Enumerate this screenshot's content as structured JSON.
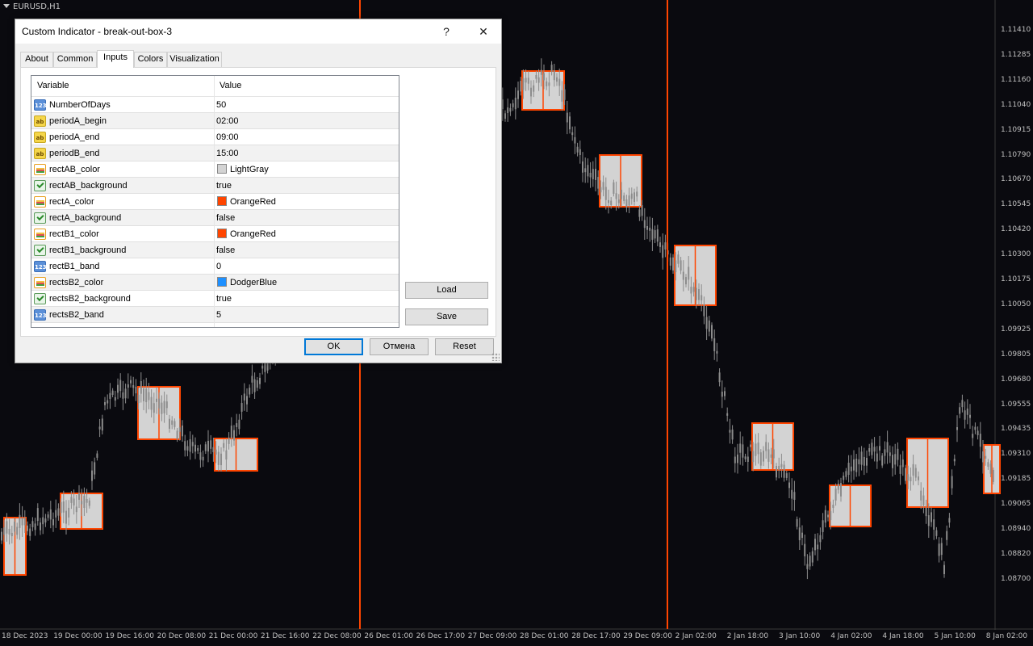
{
  "chart": {
    "symbol_label": "EURUSD,H1",
    "colors": {
      "background": "#0a0a0f",
      "candle": "#8c8c8c",
      "box_fill": "#d3d3d3",
      "box_border": "#ff4500",
      "vline": "#ff4500"
    },
    "price_labels": [
      "1.11410",
      "1.11285",
      "1.11160",
      "1.11040",
      "1.10915",
      "1.10790",
      "1.10670",
      "1.10545",
      "1.10420",
      "1.10300",
      "1.10175",
      "1.10050",
      "1.09925",
      "1.09805",
      "1.09680",
      "1.09555",
      "1.09435",
      "1.09310",
      "1.09185",
      "1.09065",
      "1.08940",
      "1.08820",
      "1.08700"
    ],
    "time_labels": [
      "18 Dec 2023",
      "19 Dec 00:00",
      "19 Dec 16:00",
      "20 Dec 08:00",
      "21 Dec 00:00",
      "21 Dec 16:00",
      "22 Dec 08:00",
      "26 Dec 01:00",
      "26 Dec 17:00",
      "27 Dec 09:00",
      "28 Dec 01:00",
      "28 Dec 17:00",
      "29 Dec 09:00",
      "2 Jan 02:00",
      "2 Jan 18:00",
      "3 Jan 10:00",
      "4 Jan 02:00",
      "4 Jan 18:00",
      "5 Jan 10:00",
      "8 Jan 02:00"
    ]
  },
  "dialog": {
    "title": "Custom Indicator - break-out-box-3",
    "help_glyph": "?",
    "close_glyph": "✕",
    "tabs": [
      "About",
      "Common",
      "Inputs",
      "Colors",
      "Visualization"
    ],
    "active_tab": "Inputs",
    "grid": {
      "col_variable": "Variable",
      "col_value": "Value",
      "rows": [
        {
          "icon": "int",
          "name": "NumberOfDays",
          "value": "50"
        },
        {
          "icon": "str",
          "name": "periodA_begin",
          "value": "02:00"
        },
        {
          "icon": "str",
          "name": "periodA_end",
          "value": "09:00"
        },
        {
          "icon": "str",
          "name": "periodB_end",
          "value": "15:00"
        },
        {
          "icon": "color",
          "name": "rectAB_color",
          "value": "LightGray",
          "swatch": "#d3d3d3"
        },
        {
          "icon": "bool",
          "name": "rectAB_background",
          "value": "true"
        },
        {
          "icon": "color",
          "name": "rectA_color",
          "value": "OrangeRed",
          "swatch": "#ff4500"
        },
        {
          "icon": "bool",
          "name": "rectA_background",
          "value": "false"
        },
        {
          "icon": "color",
          "name": "rectB1_color",
          "value": "OrangeRed",
          "swatch": "#ff4500"
        },
        {
          "icon": "bool",
          "name": "rectB1_background",
          "value": "false"
        },
        {
          "icon": "int",
          "name": "rectB1_band",
          "value": "0"
        },
        {
          "icon": "color",
          "name": "rectsB2_color",
          "value": "DodgerBlue",
          "swatch": "#1e90ff"
        },
        {
          "icon": "bool",
          "name": "rectsB2_background",
          "value": "true"
        },
        {
          "icon": "int",
          "name": "rectsB2_band",
          "value": "5"
        }
      ]
    },
    "load_label": "Load",
    "save_label": "Save",
    "ok_label": "OK",
    "cancel_label": "Отмена",
    "reset_label": "Reset"
  }
}
